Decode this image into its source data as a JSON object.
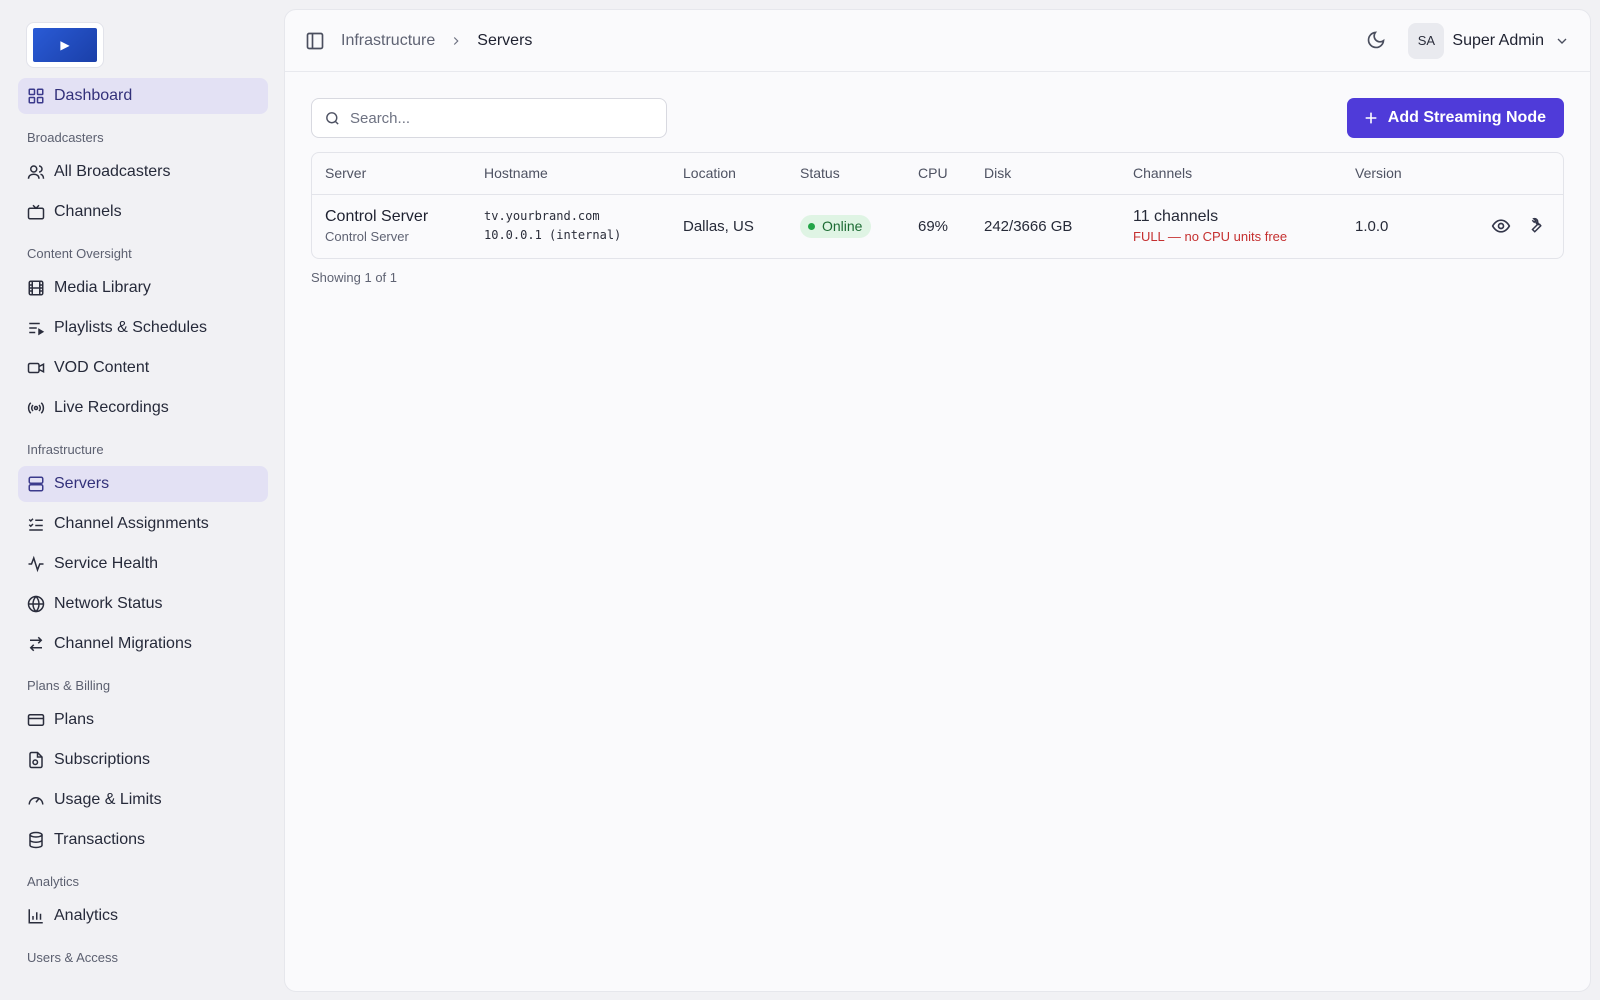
{
  "logo": {
    "glyph": "▶"
  },
  "sidebar": {
    "top_items": [
      {
        "label": "Dashboard",
        "icon": "dashboard-grid-icon",
        "active": true
      }
    ],
    "sections": [
      {
        "label": "Broadcasters",
        "items": [
          {
            "label": "All Broadcasters",
            "icon": "users-icon"
          },
          {
            "label": "Channels",
            "icon": "tv-icon"
          }
        ]
      },
      {
        "label": "Content Oversight",
        "items": [
          {
            "label": "Media Library",
            "icon": "film-icon"
          },
          {
            "label": "Playlists & Schedules",
            "icon": "playlist-icon"
          },
          {
            "label": "VOD Content",
            "icon": "video-camera-icon"
          },
          {
            "label": "Live Recordings",
            "icon": "broadcast-icon"
          }
        ]
      },
      {
        "label": "Infrastructure",
        "items": [
          {
            "label": "Servers",
            "icon": "server-icon",
            "active": true
          },
          {
            "label": "Channel Assignments",
            "icon": "list-checks-icon"
          },
          {
            "label": "Service Health",
            "icon": "activity-icon"
          },
          {
            "label": "Network Status",
            "icon": "globe-icon"
          },
          {
            "label": "Channel Migrations",
            "icon": "arrows-swap-icon"
          }
        ]
      },
      {
        "label": "Plans & Billing",
        "items": [
          {
            "label": "Plans",
            "icon": "credit-card-icon"
          },
          {
            "label": "Subscriptions",
            "icon": "subscription-icon"
          },
          {
            "label": "Usage & Limits",
            "icon": "gauge-icon"
          },
          {
            "label": "Transactions",
            "icon": "database-icon"
          }
        ]
      },
      {
        "label": "Analytics",
        "items": [
          {
            "label": "Analytics",
            "icon": "bar-chart-icon"
          }
        ]
      },
      {
        "label": "Users & Access",
        "items": []
      }
    ]
  },
  "header": {
    "breadcrumb_parent": "Infrastructure",
    "breadcrumb_current": "Servers",
    "avatar_initials": "SA",
    "user_name": "Super Admin"
  },
  "toolbar": {
    "search_placeholder": "Search...",
    "add_label": "Add Streaming Node"
  },
  "table": {
    "columns": {
      "server": "Server",
      "hostname": "Hostname",
      "location": "Location",
      "status": "Status",
      "cpu": "CPU",
      "disk": "Disk",
      "channels": "Channels",
      "version": "Version"
    },
    "rows": [
      {
        "server_name": "Control Server",
        "server_role": "Control Server",
        "hostname": "tv.yourbrand.com",
        "ip": "10.0.0.1 (internal)",
        "location": "Dallas, US",
        "status": "Online",
        "cpu": "69%",
        "disk": "242/3666 GB",
        "channels": "11 channels",
        "channels_note": "FULL — no CPU units free",
        "version": "1.0.0"
      }
    ],
    "footer": "Showing 1 of 1"
  },
  "colors": {
    "accent": "#4f3bd9",
    "active_nav_bg": "#e3e1f4",
    "online_bg": "#dff4e4",
    "online_dot": "#22a447",
    "warning_text": "#c53030"
  }
}
